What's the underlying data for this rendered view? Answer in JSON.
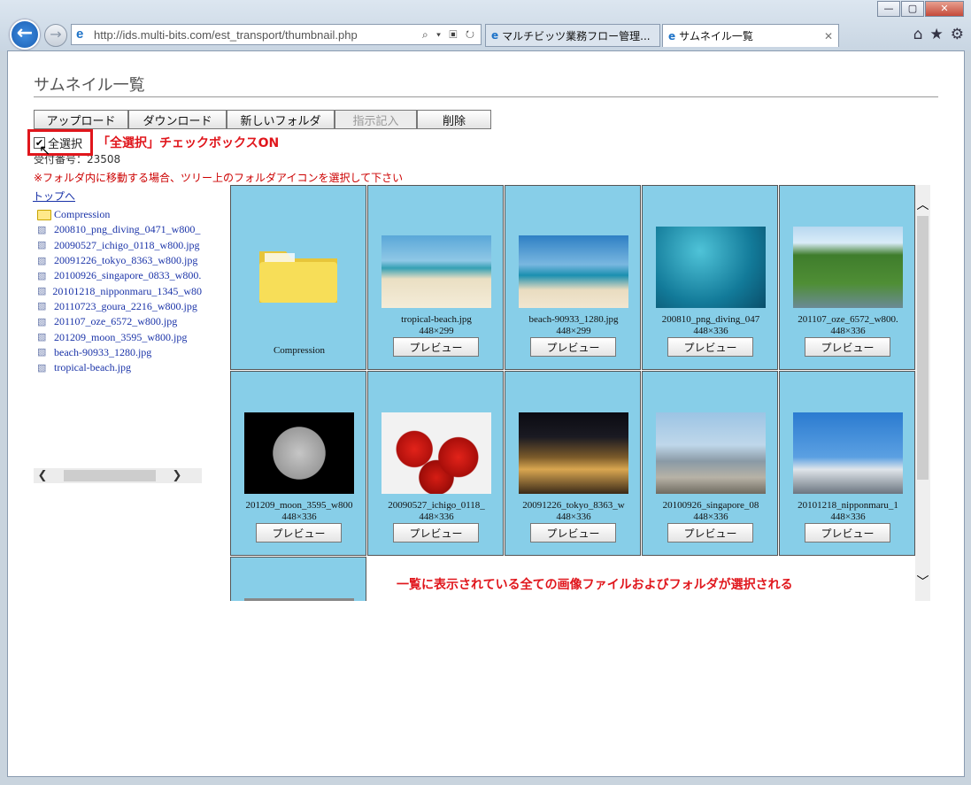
{
  "window": {
    "minimize": "—",
    "maximize": "▢",
    "close": "✕"
  },
  "browser": {
    "url": "http://ids.multi-bits.com/est_transport/thumbnail.php",
    "url_tools": "⌕ ▾ ▣ ↻",
    "tabs": [
      {
        "label": "マルチビッツ業務フロー管理..."
      },
      {
        "label": "サムネイル一覧",
        "close": "✕"
      }
    ],
    "icons": {
      "home": "⌂",
      "favorites": "★",
      "settings": "⚙"
    }
  },
  "page": {
    "title": "サムネイル一覧",
    "toolbar": [
      "アップロード",
      "ダウンロード",
      "新しいフォルダ",
      "指示記入",
      "削除"
    ],
    "select_all_label": "全選択",
    "select_all_checked": true,
    "request_no": "受付番号：23508",
    "notice": "※フォルダ内に移動する場合、ツリー上のフォルダアイコンを選択して下さい",
    "to_top": "トップへ",
    "tree": [
      {
        "type": "folder",
        "label": "Compression"
      },
      {
        "type": "image",
        "label": "200810_png_diving_0471_w800_"
      },
      {
        "type": "image",
        "label": "20090527_ichigo_0118_w800.jpg"
      },
      {
        "type": "image",
        "label": "20091226_tokyo_8363_w800.jpg"
      },
      {
        "type": "image",
        "label": "20100926_singapore_0833_w800."
      },
      {
        "type": "image",
        "label": "20101218_nipponmaru_1345_w80"
      },
      {
        "type": "image",
        "label": "20110723_goura_2216_w800.jpg"
      },
      {
        "type": "image",
        "label": "201107_oze_6572_w800.jpg"
      },
      {
        "type": "image",
        "label": "201209_moon_3595_w800.jpg"
      },
      {
        "type": "image",
        "label": "beach-90933_1280.jpg"
      },
      {
        "type": "image",
        "label": "tropical-beach.jpg"
      }
    ],
    "preview_label": "プレビュー",
    "items": [
      {
        "kind": "folder",
        "name": "Compression"
      },
      {
        "kind": "image",
        "name": "tropical-beach.jpg",
        "size": "448×299",
        "picture": "beach"
      },
      {
        "kind": "image",
        "name": "beach-90933_1280.jpg",
        "size": "448×299",
        "picture": "beach2"
      },
      {
        "kind": "image",
        "name": "200810_png_diving_047",
        "size": "448×336",
        "picture": "diving"
      },
      {
        "kind": "image",
        "name": "201107_oze_6572_w800.",
        "size": "448×336",
        "picture": "river"
      },
      {
        "kind": "image",
        "name": "201209_moon_3595_w800",
        "size": "448×336",
        "picture": "moon"
      },
      {
        "kind": "image",
        "name": "20090527_ichigo_0118_",
        "size": "448×336",
        "picture": "strawberry"
      },
      {
        "kind": "image",
        "name": "20091226_tokyo_8363_w",
        "size": "448×336",
        "picture": "tokyo"
      },
      {
        "kind": "image",
        "name": "20100926_singapore_08",
        "size": "448×336",
        "picture": "singapore"
      },
      {
        "kind": "image",
        "name": "20101218_nipponmaru_1",
        "size": "448×336",
        "picture": "ship"
      },
      {
        "kind": "image",
        "name": "",
        "size": "",
        "picture": "partial"
      }
    ],
    "annotations": {
      "select_all": "「全選択」チェックボックスON",
      "result": "一覧に表示されている全ての画像ファイルおよびフォルダが選択される"
    },
    "colors": {
      "cell_bg": "#87cee8",
      "annotation": "#e0161c",
      "link": "#1a33a8"
    }
  }
}
